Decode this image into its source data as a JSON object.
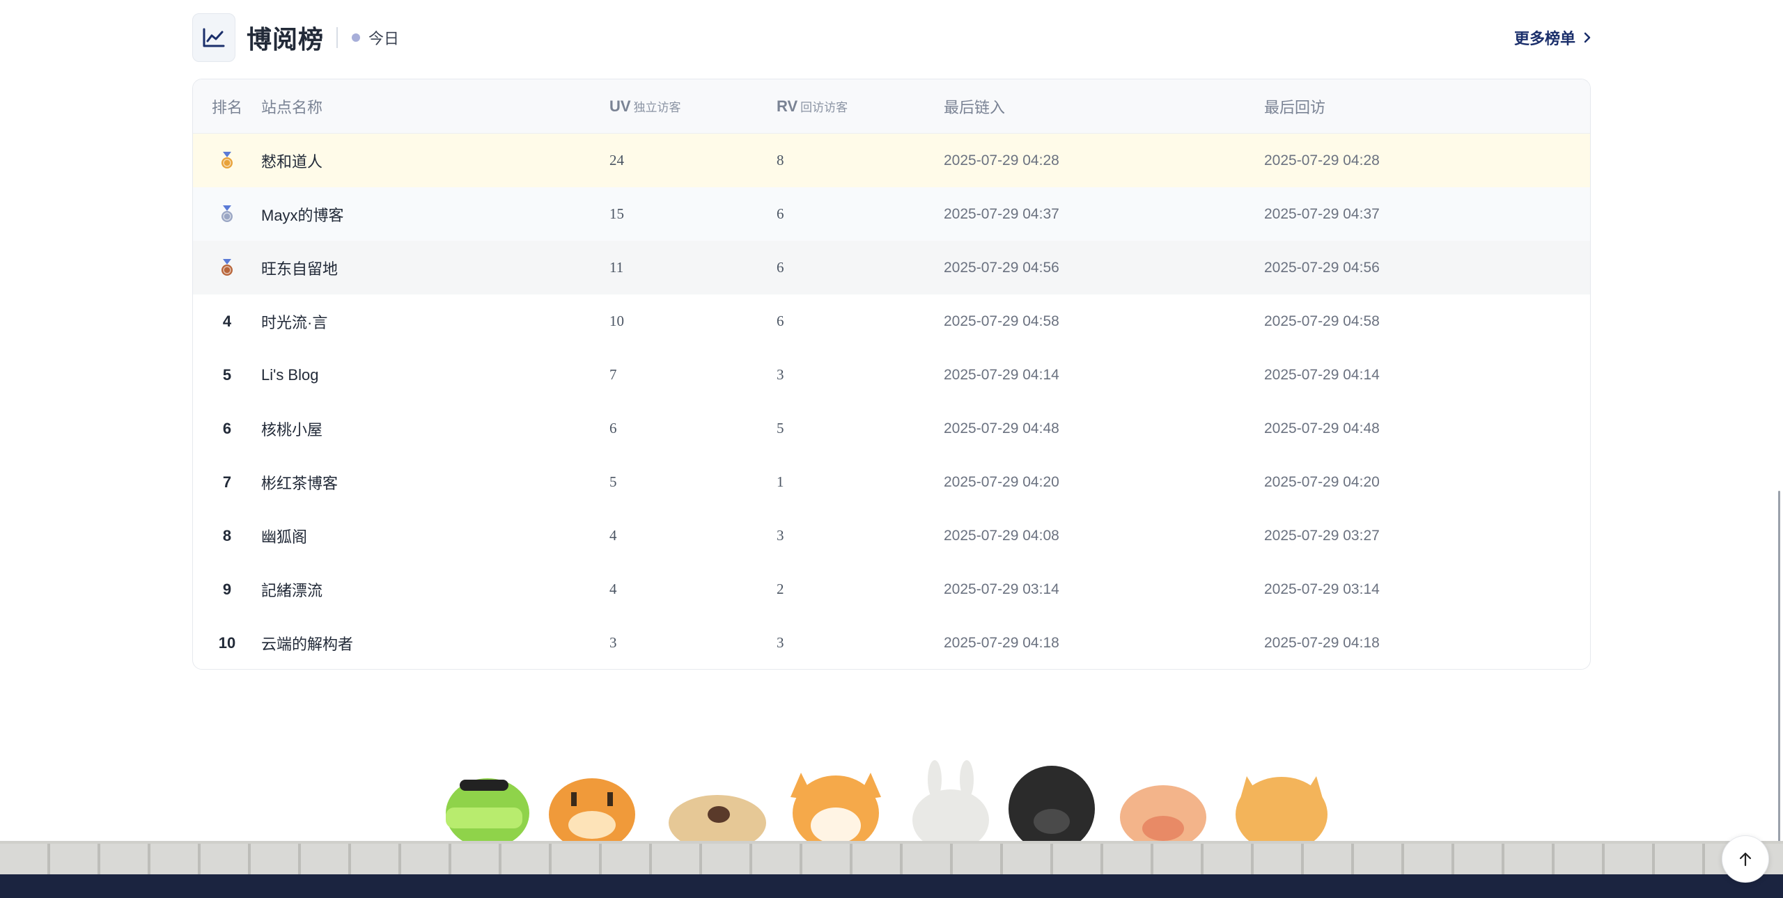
{
  "header": {
    "title": "博阅榜",
    "period": "今日",
    "more_label": "更多榜单"
  },
  "table": {
    "columns": {
      "rank": "排名",
      "name": "站点名称",
      "uv": "UV",
      "uv_sub": "独立访客",
      "rv": "RV",
      "rv_sub": "回访访客",
      "last_in": "最后链入",
      "last_visit": "最后回访"
    },
    "rows": [
      {
        "rank": "1",
        "name": "慭和道人",
        "uv": "24",
        "rv": "8",
        "last_in": "2025-07-29 04:28",
        "last_visit": "2025-07-29 04:28"
      },
      {
        "rank": "2",
        "name": "Mayx的博客",
        "uv": "15",
        "rv": "6",
        "last_in": "2025-07-29 04:37",
        "last_visit": "2025-07-29 04:37"
      },
      {
        "rank": "3",
        "name": "旺东自留地",
        "uv": "11",
        "rv": "6",
        "last_in": "2025-07-29 04:56",
        "last_visit": "2025-07-29 04:56"
      },
      {
        "rank": "4",
        "name": "时光流·言",
        "uv": "10",
        "rv": "6",
        "last_in": "2025-07-29 04:58",
        "last_visit": "2025-07-29 04:58"
      },
      {
        "rank": "5",
        "name": "Li's Blog",
        "uv": "7",
        "rv": "3",
        "last_in": "2025-07-29 04:14",
        "last_visit": "2025-07-29 04:14"
      },
      {
        "rank": "6",
        "name": "核桃小屋",
        "uv": "6",
        "rv": "5",
        "last_in": "2025-07-29 04:48",
        "last_visit": "2025-07-29 04:48"
      },
      {
        "rank": "7",
        "name": "彬红茶博客",
        "uv": "5",
        "rv": "1",
        "last_in": "2025-07-29 04:20",
        "last_visit": "2025-07-29 04:20"
      },
      {
        "rank": "8",
        "name": "幽狐阁",
        "uv": "4",
        "rv": "3",
        "last_in": "2025-07-29 04:08",
        "last_visit": "2025-07-29 03:27"
      },
      {
        "rank": "9",
        "name": "記緒漂流",
        "uv": "4",
        "rv": "2",
        "last_in": "2025-07-29 03:14",
        "last_visit": "2025-07-29 03:14"
      },
      {
        "rank": "10",
        "name": "云端的解构者",
        "uv": "3",
        "rv": "3",
        "last_in": "2025-07-29 04:18",
        "last_visit": "2025-07-29 04:18"
      }
    ]
  },
  "colors": {
    "gold": "#e8a23a",
    "silver": "#9aa6c4",
    "bronze": "#b8653a",
    "brand": "#1b2f6b"
  },
  "icons": {
    "logo": "chart-line-icon",
    "more": "chevron-right-icon",
    "to_top": "arrow-up-icon"
  }
}
